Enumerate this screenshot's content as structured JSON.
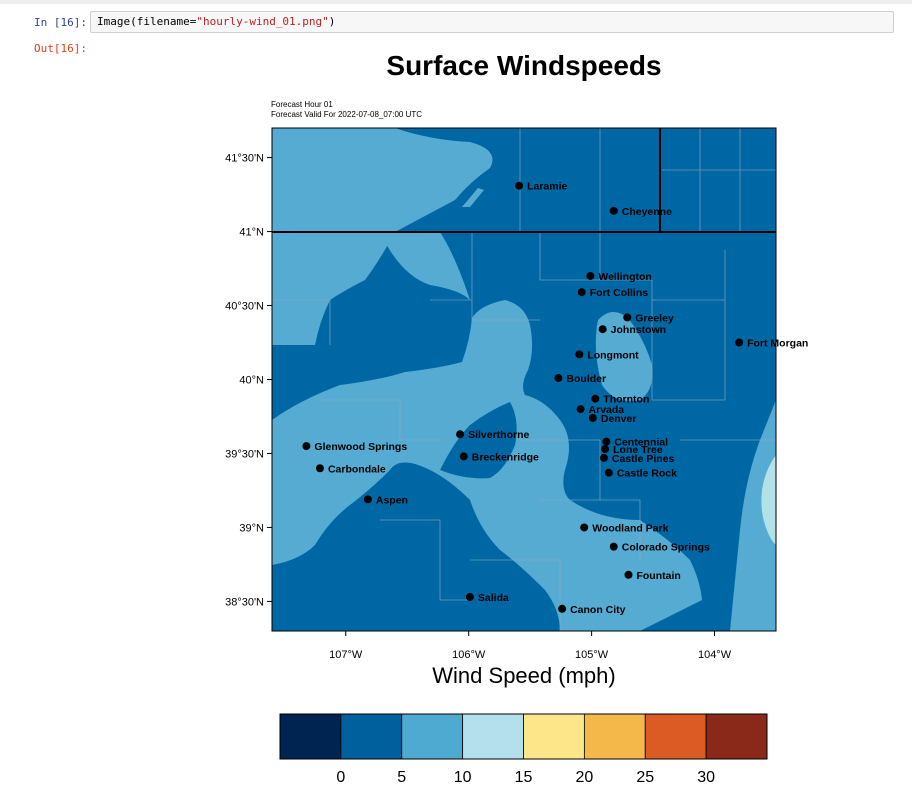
{
  "notebook": {
    "in_prompt": "In [16]:",
    "out_prompt": "Out[16]:",
    "code_prefix": "Image(filename=",
    "code_string": "\"hourly-wind_01.png\"",
    "code_suffix": ")"
  },
  "figure": {
    "title": "Surface Windspeeds",
    "forecast_hour": "Forecast Hour 01",
    "forecast_valid": "Forecast Valid For 2022-07-08_07:00 UTC",
    "lat_labels": [
      "41°30'N",
      "41°N",
      "40°30'N",
      "40°N",
      "39°30'N",
      "39°N",
      "38°30'N"
    ],
    "lon_labels": [
      "107°W",
      "106°W",
      "105°W",
      "104°W"
    ],
    "xlabel": "Wind Speed (mph)",
    "cities": [
      {
        "name": "Laramie",
        "lon": -105.59,
        "lat": 41.31
      },
      {
        "name": "Cheyenne",
        "lon": -104.82,
        "lat": 41.14
      },
      {
        "name": "Wellington",
        "lon": -105.01,
        "lat": 40.7
      },
      {
        "name": "Fort Collins",
        "lon": -105.08,
        "lat": 40.59
      },
      {
        "name": "Greeley",
        "lon": -104.71,
        "lat": 40.42
      },
      {
        "name": "Johnstown",
        "lon": -104.91,
        "lat": 40.34
      },
      {
        "name": "Fort Morgan",
        "lon": -103.8,
        "lat": 40.25
      },
      {
        "name": "Longmont",
        "lon": -105.1,
        "lat": 40.17
      },
      {
        "name": "Boulder",
        "lon": -105.27,
        "lat": 40.01
      },
      {
        "name": "Thornton",
        "lon": -104.97,
        "lat": 39.87
      },
      {
        "name": "Arvada",
        "lon": -105.09,
        "lat": 39.8
      },
      {
        "name": "Denver",
        "lon": -104.99,
        "lat": 39.74
      },
      {
        "name": "Silverthorne",
        "lon": -106.07,
        "lat": 39.63
      },
      {
        "name": "Glenwood Springs",
        "lon": -107.32,
        "lat": 39.55
      },
      {
        "name": "Centennial",
        "lon": -104.88,
        "lat": 39.58
      },
      {
        "name": "Lone Tree",
        "lon": -104.89,
        "lat": 39.53
      },
      {
        "name": "Breckenridge",
        "lon": -106.04,
        "lat": 39.48
      },
      {
        "name": "Castle Pines",
        "lon": -104.9,
        "lat": 39.47
      },
      {
        "name": "Carbondale",
        "lon": -107.21,
        "lat": 39.4
      },
      {
        "name": "Castle Rock",
        "lon": -104.86,
        "lat": 39.37
      },
      {
        "name": "Aspen",
        "lon": -106.82,
        "lat": 39.19
      },
      {
        "name": "Woodland Park",
        "lon": -105.06,
        "lat": 39.0
      },
      {
        "name": "Colorado Springs",
        "lon": -104.82,
        "lat": 38.87
      },
      {
        "name": "Fountain",
        "lon": -104.7,
        "lat": 38.68
      },
      {
        "name": "Salida",
        "lon": -105.99,
        "lat": 38.53
      },
      {
        "name": "Canon City",
        "lon": -105.24,
        "lat": 38.45
      }
    ]
  },
  "colorbar": {
    "colors": [
      "#002451",
      "#00609e",
      "#4eaad1",
      "#b3e0ec",
      "#fde68a",
      "#f3b849",
      "#dc5a23",
      "#8a2819"
    ],
    "labels": [
      "0",
      "5",
      "10",
      "15",
      "20",
      "25",
      "30"
    ]
  },
  "map_colors": {
    "band_5_10": "#0067a5",
    "band_10_15": "#55abd2",
    "band_15_20": "#b2e2e8"
  }
}
